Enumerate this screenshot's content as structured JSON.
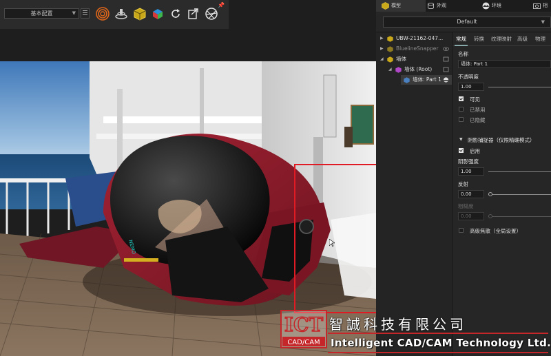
{
  "toolbar": {
    "preset_value": "基本配置",
    "icons": [
      "target-icon",
      "turntable-icon",
      "cube-icon",
      "color-cube-icon",
      "refresh-icon",
      "export-icon",
      "aperture-icon",
      "pin-icon"
    ]
  },
  "right_tabs": [
    {
      "label": "模型",
      "icon": "cube-icon"
    },
    {
      "label": "外观",
      "icon": "material-icon"
    },
    {
      "label": "环境",
      "icon": "environment-icon"
    },
    {
      "label": "相",
      "icon": "camera-icon"
    }
  ],
  "config_select": "Default",
  "tree": [
    {
      "label": "UBW-21162-047...",
      "indent": 0,
      "expanded": false
    },
    {
      "label": "BluelineSnapper",
      "indent": 0,
      "expanded": false
    },
    {
      "label": "墙体",
      "indent": 0,
      "expanded": true
    },
    {
      "label": "墙体 (Root)",
      "indent": 1,
      "expanded": true
    },
    {
      "label": "墙体: Part 1",
      "indent": 2,
      "expanded": false
    }
  ],
  "prop_tabs": [
    "常规",
    "转换",
    "纹理映射",
    "高级",
    "物理"
  ],
  "props": {
    "name_label": "名称",
    "name_value": "墙体: Part 1",
    "opacity_label": "不透明度",
    "opacity_value": "1.00",
    "opacity": 1.0,
    "visible_label": "可见",
    "visible_checked": true,
    "disabled_label": "已禁用",
    "disabled_checked": false,
    "hidden_label": "已隐藏",
    "hidden_checked": false,
    "shadow_section": "阴影捕捉器（仅限精确模式）",
    "enable_label": "启用",
    "enable_checked": true,
    "shadow_strength_label": "阴影强度",
    "shadow_strength_value": "1.00",
    "shadow_strength": 1.0,
    "reflection_label": "反射",
    "reflection_value": "0.00",
    "reflection": 0.0,
    "roughness_label": "粗糙度",
    "roughness_value": "0.00",
    "roughness": 0.0,
    "caustics_label": "高级焦散（全局设置）",
    "caustics_checked": false
  },
  "watermark": {
    "logo_top": "ICT",
    "logo_bottom": "CAD/CAM",
    "company_cn": "智誠科技有限公司",
    "company_en": "Intelligent CAD/CAM Technology Ltd."
  },
  "colors": {
    "selection_rect": "#e01b24",
    "submarine_body": "#8e1a28",
    "accent_yellow": "#e0c020"
  }
}
